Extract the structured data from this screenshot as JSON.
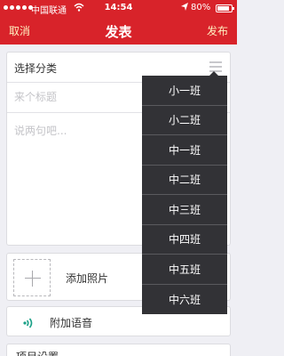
{
  "status_bar": {
    "carrier": "中国联通",
    "time": "14:54",
    "battery": "80%",
    "battery_level": 0.8
  },
  "nav": {
    "cancel_label": "取消",
    "title": "发表",
    "publish_label": "发布"
  },
  "form": {
    "category_label": "选择分类",
    "title_placeholder": "来个标题",
    "body_placeholder": "说两句吧..."
  },
  "attachments": {
    "add_photo_label": "添加照片",
    "add_voice_label": "附加语音",
    "more_label": "项目设置"
  },
  "dropdown": {
    "items": [
      "小一班",
      "小二班",
      "中一班",
      "中二班",
      "中三班",
      "中四班",
      "中五班",
      "中六班"
    ]
  },
  "colors": {
    "brand_red": "#d8232a",
    "nav_action": "#fff0c0",
    "dropdown_bg": "#323236",
    "voice_icon": "#1aa087"
  }
}
